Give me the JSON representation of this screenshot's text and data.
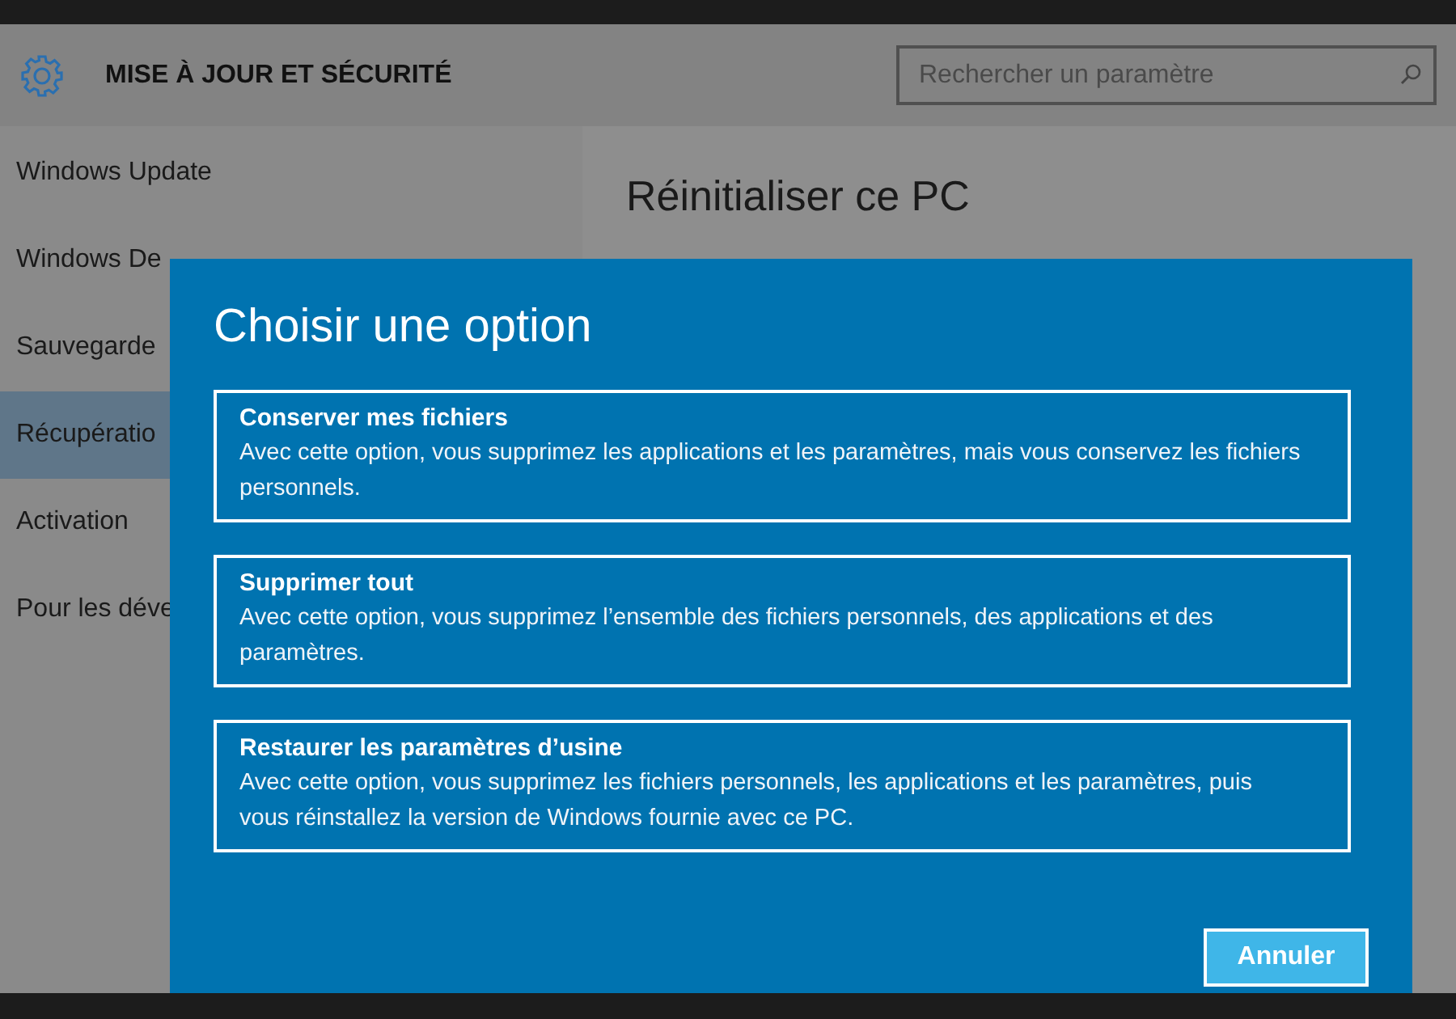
{
  "header": {
    "title": "MISE À JOUR ET SÉCURITÉ"
  },
  "search": {
    "placeholder": "Rechercher un paramètre"
  },
  "sidebar": {
    "items": [
      {
        "label": "Windows Update",
        "selected": false
      },
      {
        "label": "Windows De",
        "selected": false
      },
      {
        "label": "Sauvegarde",
        "selected": false
      },
      {
        "label": "Récupératio",
        "selected": true
      },
      {
        "label": "Activation",
        "selected": false
      },
      {
        "label": "Pour les déve",
        "selected": false
      }
    ]
  },
  "content": {
    "title": "Réinitialiser ce PC"
  },
  "dialog": {
    "title": "Choisir une option",
    "options": [
      {
        "title": "Conserver mes fichiers",
        "description": "Avec cette option, vous supprimez les applications et les paramètres, mais vous conservez les fichiers personnels."
      },
      {
        "title": "Supprimer tout",
        "description": "Avec cette option, vous supprimez l’ensemble des fichiers personnels, des applications et des paramètres."
      },
      {
        "title": "Restaurer les paramètres d’usine",
        "description": "Avec cette option, vous supprimez les fichiers personnels, les applications et les paramètres, puis vous réinstallez la version de Windows fournie avec ce PC."
      }
    ],
    "buttons": [
      "Annuler"
    ]
  }
}
